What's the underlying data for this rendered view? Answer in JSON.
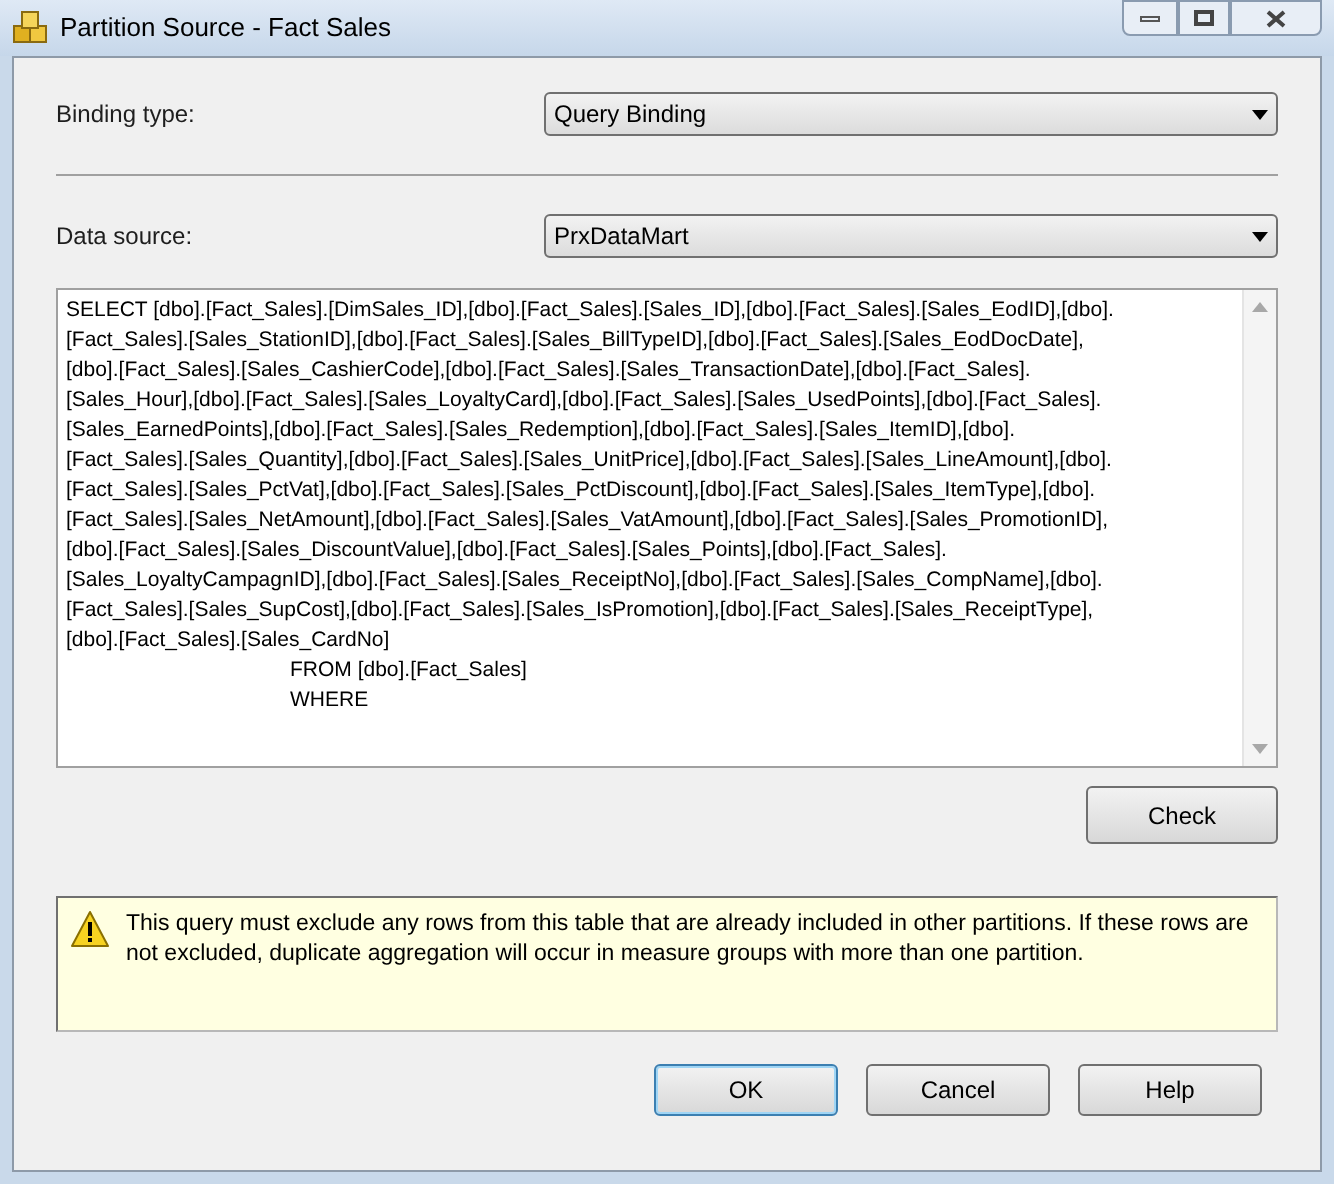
{
  "window": {
    "title": "Partition Source - Fact Sales"
  },
  "binding_type": {
    "label": "Binding type:",
    "value": "Query Binding"
  },
  "data_source": {
    "label": "Data source:",
    "value": "PrxDataMart"
  },
  "query": {
    "lines": [
      {
        "text": "SELECT [dbo].[Fact_Sales].[DimSales_ID],[dbo].[Fact_Sales].[Sales_ID],[dbo].[Fact_Sales].[Sales_EodID],[dbo].",
        "indented": false
      },
      {
        "text": "[Fact_Sales].[Sales_StationID],[dbo].[Fact_Sales].[Sales_BillTypeID],[dbo].[Fact_Sales].[Sales_EodDocDate],",
        "indented": false
      },
      {
        "text": "[dbo].[Fact_Sales].[Sales_CashierCode],[dbo].[Fact_Sales].[Sales_TransactionDate],[dbo].[Fact_Sales].",
        "indented": false
      },
      {
        "text": "[Sales_Hour],[dbo].[Fact_Sales].[Sales_LoyaltyCard],[dbo].[Fact_Sales].[Sales_UsedPoints],[dbo].[Fact_Sales].",
        "indented": false
      },
      {
        "text": "[Sales_EarnedPoints],[dbo].[Fact_Sales].[Sales_Redemption],[dbo].[Fact_Sales].[Sales_ItemID],[dbo].",
        "indented": false
      },
      {
        "text": "[Fact_Sales].[Sales_Quantity],[dbo].[Fact_Sales].[Sales_UnitPrice],[dbo].[Fact_Sales].[Sales_LineAmount],[dbo].",
        "indented": false
      },
      {
        "text": "[Fact_Sales].[Sales_PctVat],[dbo].[Fact_Sales].[Sales_PctDiscount],[dbo].[Fact_Sales].[Sales_ItemType],[dbo].",
        "indented": false
      },
      {
        "text": "[Fact_Sales].[Sales_NetAmount],[dbo].[Fact_Sales].[Sales_VatAmount],[dbo].[Fact_Sales].[Sales_PromotionID],",
        "indented": false
      },
      {
        "text": "[dbo].[Fact_Sales].[Sales_DiscountValue],[dbo].[Fact_Sales].[Sales_Points],[dbo].[Fact_Sales].",
        "indented": false
      },
      {
        "text": "[Sales_LoyaltyCampagnID],[dbo].[Fact_Sales].[Sales_ReceiptNo],[dbo].[Fact_Sales].[Sales_CompName],[dbo].",
        "indented": false
      },
      {
        "text": "[Fact_Sales].[Sales_SupCost],[dbo].[Fact_Sales].[Sales_IsPromotion],[dbo].[Fact_Sales].[Sales_ReceiptType],",
        "indented": false
      },
      {
        "text": "[dbo].[Fact_Sales].[Sales_CardNo]",
        "indented": false
      },
      {
        "text": "FROM [dbo].[Fact_Sales]",
        "indented": true
      },
      {
        "text": "WHERE",
        "indented": true
      }
    ]
  },
  "check_button": "Check",
  "warning": "This query must exclude any rows from this table that are already included in other partitions. If these rows are not excluded, duplicate aggregation will occur in measure groups with more than one partition.",
  "buttons": [
    {
      "label": "OK",
      "default": true
    },
    {
      "label": "Cancel",
      "default": false
    },
    {
      "label": "Help",
      "default": false
    }
  ]
}
